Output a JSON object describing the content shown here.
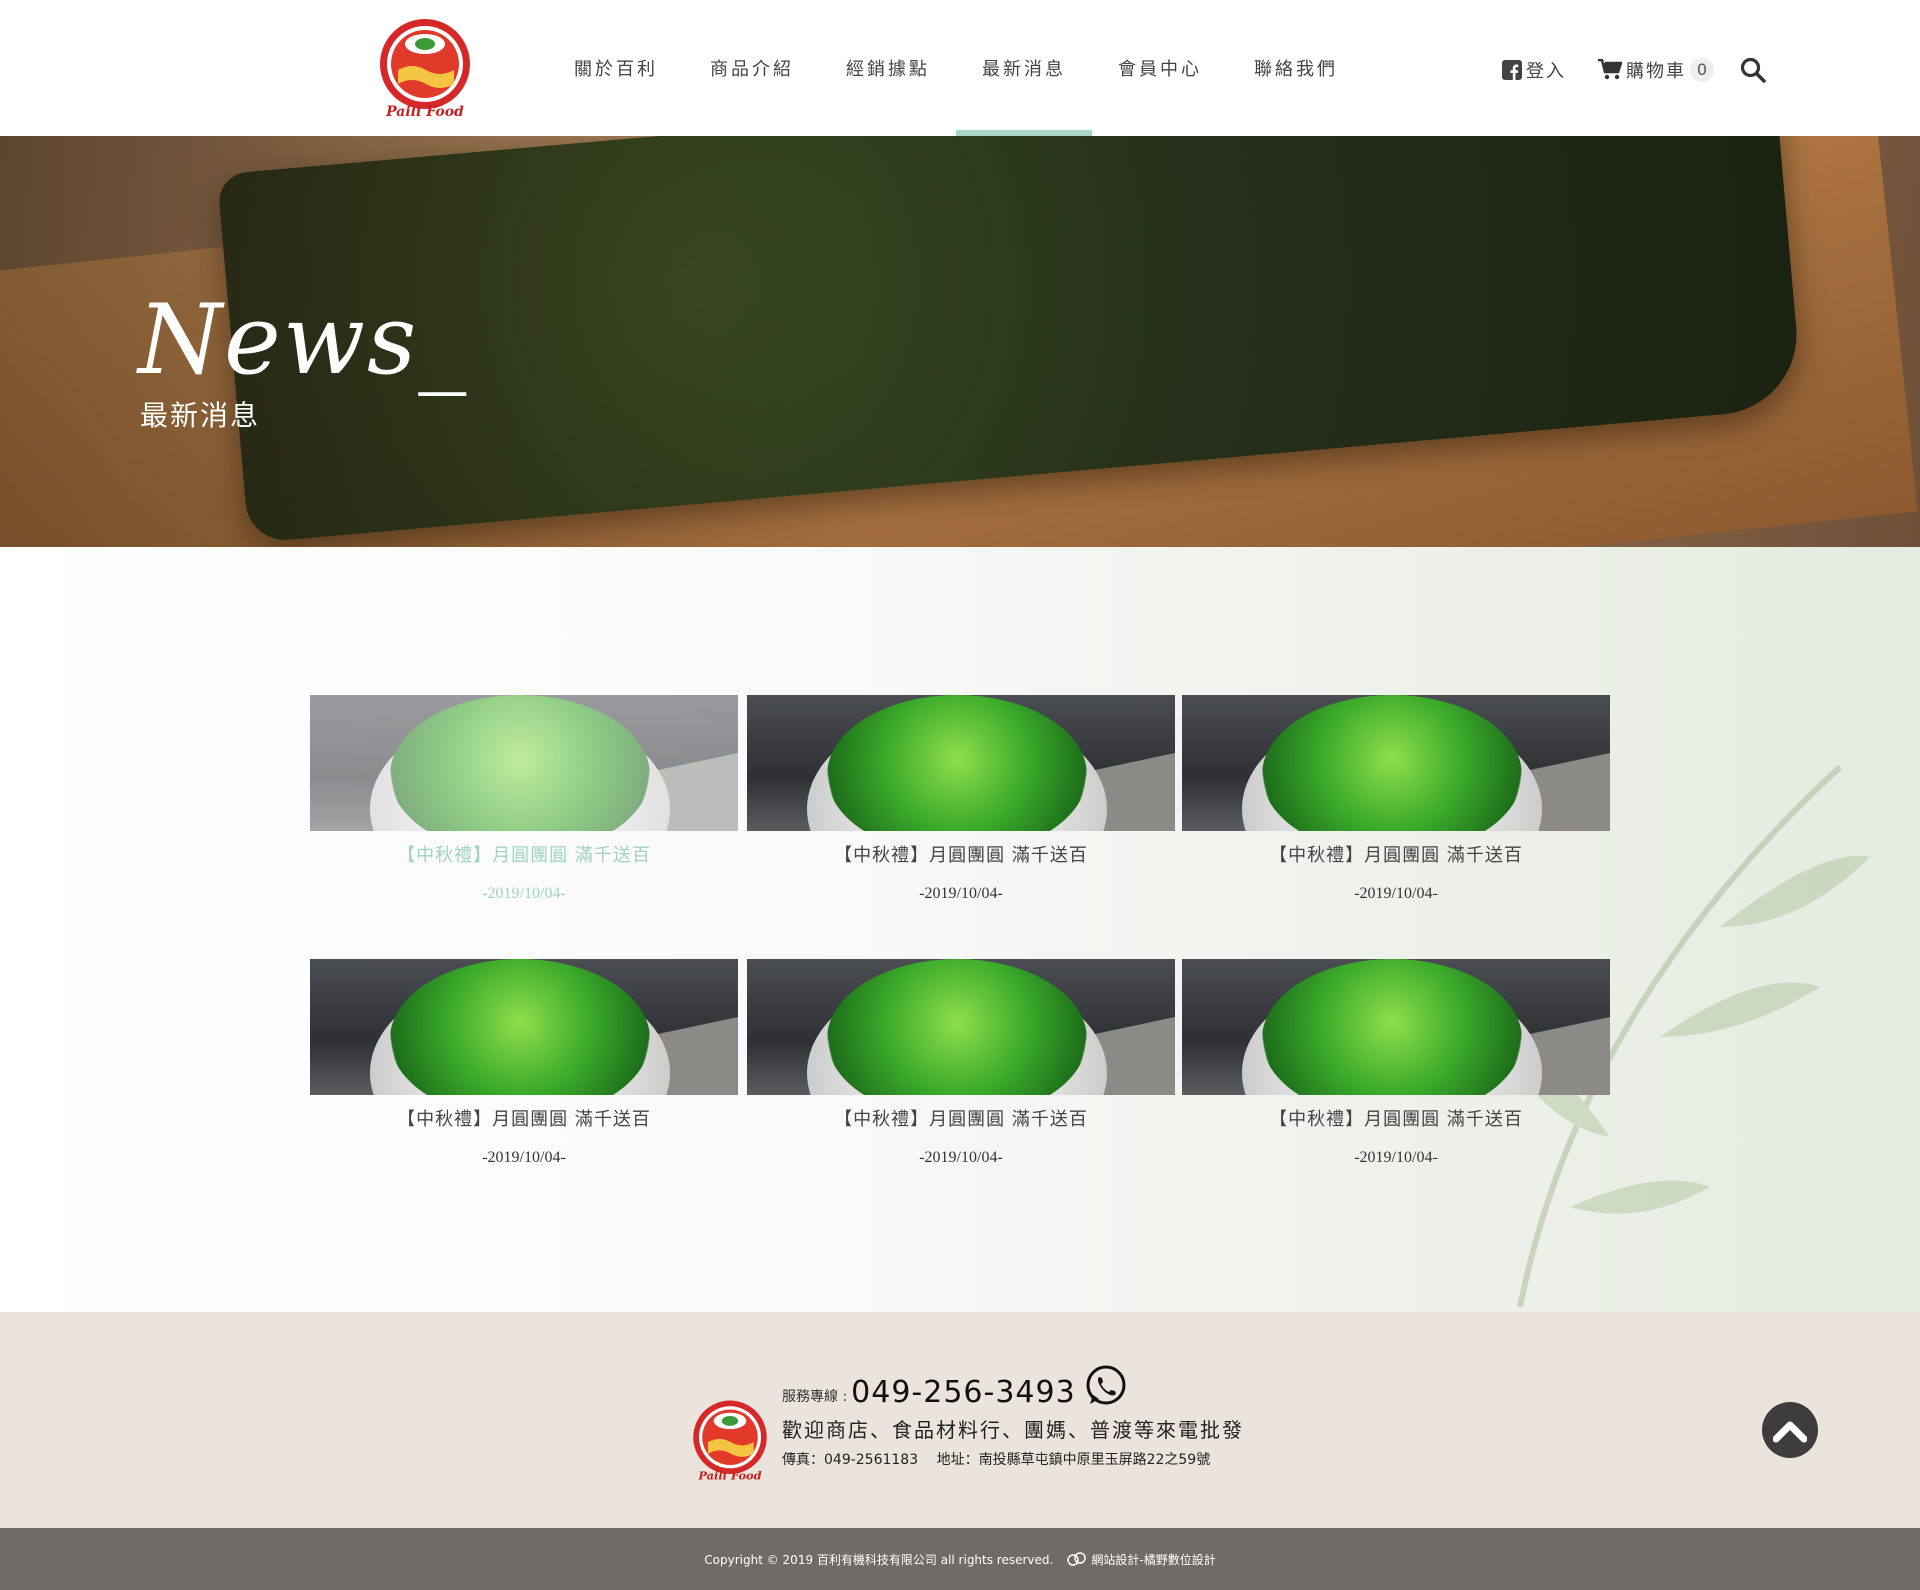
{
  "header": {
    "logo_text": "Paili Food",
    "nav": [
      {
        "label": "關於百利"
      },
      {
        "label": "商品介紹"
      },
      {
        "label": "經銷據點"
      },
      {
        "label": "最新消息"
      },
      {
        "label": "會員中心"
      },
      {
        "label": "聯絡我們"
      }
    ],
    "active_nav": "最新消息",
    "login_label": "登入",
    "cart_label": "購物車",
    "cart_count": "0"
  },
  "hero": {
    "title": "News_",
    "subtitle": "最新消息"
  },
  "news": [
    {
      "title": "【中秋禮】月圓團圓 滿千送百",
      "date": "-2019/10/04-"
    },
    {
      "title": "【中秋禮】月圓團圓 滿千送百",
      "date": "-2019/10/04-"
    },
    {
      "title": "【中秋禮】月圓團圓 滿千送百",
      "date": "-2019/10/04-"
    },
    {
      "title": "【中秋禮】月圓團圓 滿千送百",
      "date": "-2019/10/04-"
    },
    {
      "title": "【中秋禮】月圓團圓 滿千送百",
      "date": "-2019/10/04-"
    },
    {
      "title": "【中秋禮】月圓團圓 滿千送百",
      "date": "-2019/10/04-"
    }
  ],
  "footer": {
    "hotline_label": "服務專線 :",
    "hotline_number": "049-256-3493",
    "slogan": "歡迎商店、食品材料行、團媽、普渡等來電批發",
    "contact": "傳真：049-2561183　 地址：南投縣草屯鎮中原里玉屏路22之59號",
    "copyright": "Copyright © 2019 百利有機科技有限公司 all rights reserved.",
    "credit": "網站設計-橘野數位設計"
  },
  "colors": {
    "accent": "#a9d8cb",
    "footer_bg": "#ebe4dc",
    "copyright_bg": "#6f6b67",
    "logo_red": "#d62828"
  }
}
